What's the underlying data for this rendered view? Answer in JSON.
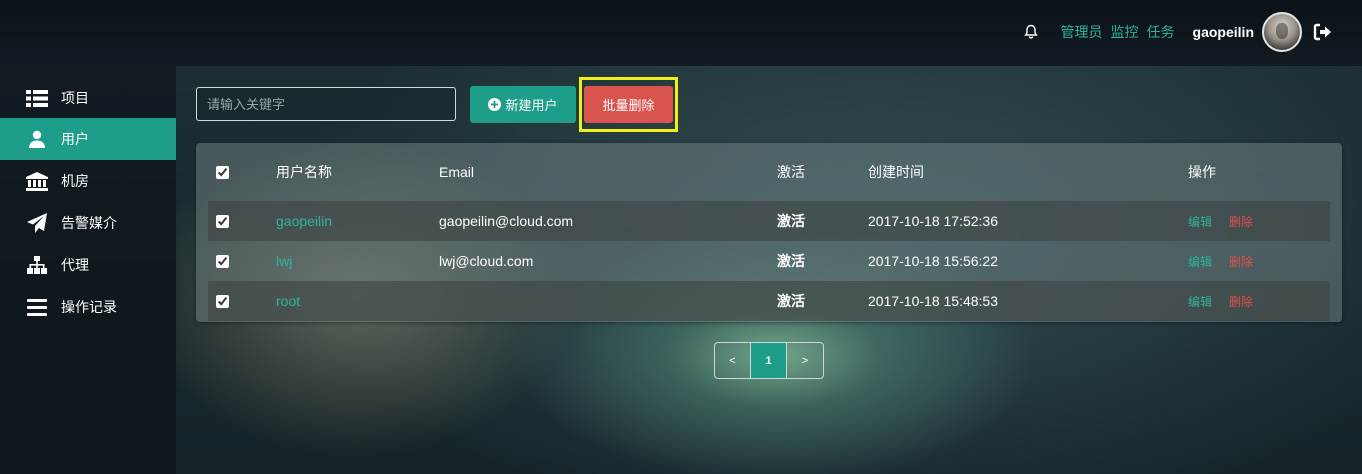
{
  "header": {
    "nav": [
      "管理员",
      "监控",
      "任务"
    ],
    "username": "gaopeilin"
  },
  "sidebar": {
    "items": [
      {
        "label": "项目",
        "icon": "list-icon"
      },
      {
        "label": "用户",
        "icon": "user-icon",
        "active": true
      },
      {
        "label": "机房",
        "icon": "bank-icon"
      },
      {
        "label": "告警媒介",
        "icon": "send-icon"
      },
      {
        "label": "代理",
        "icon": "sitemap-icon"
      },
      {
        "label": "操作记录",
        "icon": "menu-icon"
      }
    ]
  },
  "toolbar": {
    "search_placeholder": "请输入关键字",
    "new_user_label": "新建用户",
    "batch_delete_label": "批量删除"
  },
  "table": {
    "headers": [
      "用户名称",
      "Email",
      "激活",
      "创建时间",
      "操作"
    ],
    "rows": [
      {
        "name": "gaopeilin",
        "email": "gaopeilin@cloud.com",
        "active": "激活",
        "created": "2017-10-18 17:52:36"
      },
      {
        "name": "lwj",
        "email": "lwj@cloud.com",
        "active": "激活",
        "created": "2017-10-18 15:56:22"
      },
      {
        "name": "root",
        "email": "",
        "active": "激活",
        "created": "2017-10-18 15:48:53"
      }
    ],
    "edit_label": "编辑",
    "delete_label": "删除"
  },
  "pagination": {
    "prev": "<",
    "current": "1",
    "next": ">"
  },
  "colors": {
    "accent": "#1e9d8a",
    "danger": "#d9534f",
    "highlight": "#f2ef17"
  }
}
